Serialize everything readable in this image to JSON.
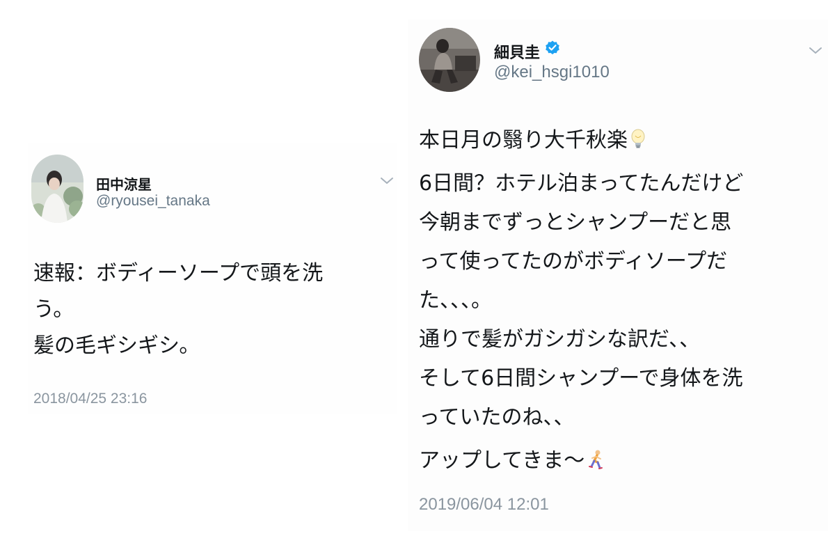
{
  "tweets": [
    {
      "display_name": "田中涼星",
      "handle": "@ryousei_tanaka",
      "verified": false,
      "avatar_icon": "profile-photo-avatar",
      "menu_icon": "chevron-down-icon",
      "body_lines": [
        "速報：ボディーソープで頭を洗",
        "う。",
        "髪の毛ギシギシ。"
      ],
      "timestamp": "2018/04/25 23:16"
    },
    {
      "display_name": "細貝圭",
      "handle": "@kei_hsgi1010",
      "verified": true,
      "verified_icon": "verified-badge-icon",
      "avatar_icon": "profile-photo-avatar",
      "menu_icon": "chevron-down-icon",
      "body_lines": [
        "本日月の翳り大千秋楽",
        "6日間？ホテル泊まってたんだけど",
        "今朝までずっとシャンプーだと思",
        "って使ってたのがボディソープだ",
        "た、、、。",
        "通りで髪がガシガシな訳だ、、",
        "そして6日間シャンプーで身体を洗",
        "っていたのね、、",
        "アップしてきま〜"
      ],
      "emoji": {
        "line_0": "light-bulb-emoji",
        "line_8": "runner-emoji"
      },
      "timestamp": "2019/06/04 12:01"
    }
  ],
  "colors": {
    "text": "#14171a",
    "secondary": "#657786",
    "verified": "#1da1f2"
  }
}
